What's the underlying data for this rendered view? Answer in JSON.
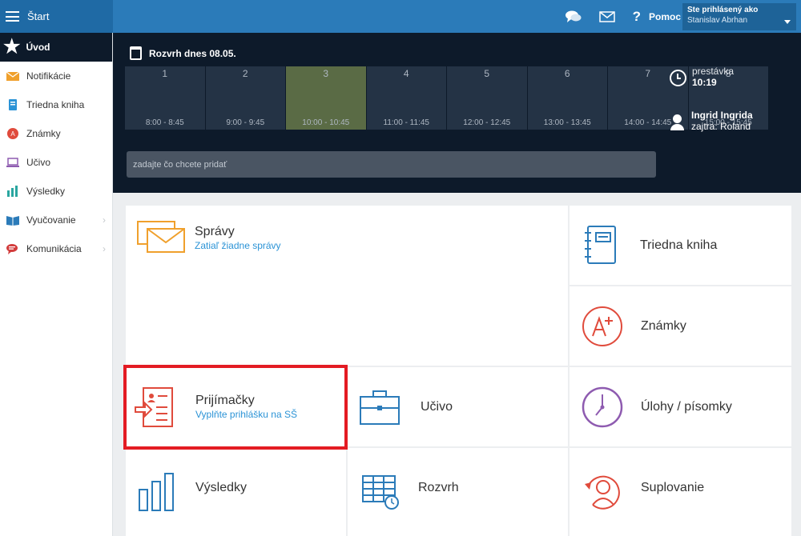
{
  "header": {
    "menu_label": "Štart",
    "help_label": "Pomoc",
    "user_label": "Ste prihlásený ako",
    "user_name": "Stanislav Abrhan"
  },
  "sidebar": {
    "active": "Úvod",
    "items": [
      {
        "label": "Notifikácie",
        "icon": "envelope-icon",
        "color": "#f0a02c"
      },
      {
        "label": "Triedna kniha",
        "icon": "book-icon",
        "color": "#2b93d6"
      },
      {
        "label": "Známky",
        "icon": "grade-icon",
        "color": "#e04b3c"
      },
      {
        "label": "Učivo",
        "icon": "laptop-icon",
        "color": "#8e5bb0"
      },
      {
        "label": "Výsledky",
        "icon": "chart-icon",
        "color": "#2aa6a0"
      },
      {
        "label": "Vyučovanie",
        "icon": "open-book-icon",
        "color": "#2b7bb9"
      },
      {
        "label": "Komunikácia",
        "icon": "chat-icon",
        "color": "#d23c3c"
      }
    ]
  },
  "schedule": {
    "title": "Rozvrh dnes 08.05.",
    "lessons": [
      {
        "num": "1",
        "time": "8:00 - 8:45"
      },
      {
        "num": "2",
        "time": "9:00 - 9:45"
      },
      {
        "num": "3",
        "time": "10:00 - 10:45"
      },
      {
        "num": "4",
        "time": "11:00 - 11:45"
      },
      {
        "num": "5",
        "time": "12:00 - 12:45"
      },
      {
        "num": "6",
        "time": "13:00 - 13:45"
      },
      {
        "num": "7",
        "time": "14:00 - 14:45"
      },
      {
        "num": "8",
        "time": "15:00 - 15:45"
      }
    ],
    "current_lesson": "3",
    "add_placeholder": "zadajte čo chcete pridať",
    "break_label": "prestávka",
    "break_time": "10:19",
    "person_name": "Ingrid Ingrida",
    "tomorrow": "zajtra: Roland"
  },
  "tiles": {
    "spravy": {
      "title": "Správy",
      "sub": "Zatiaľ žiadne správy"
    },
    "triedna": {
      "title": "Triedna kniha"
    },
    "znamky": {
      "title": "Známky"
    },
    "prijimacky": {
      "title": "Prijímačky",
      "sub": "Vyplňte prihlášku na SŠ"
    },
    "ucivo": {
      "title": "Učivo"
    },
    "ulohy": {
      "title": "Úlohy / písomky"
    },
    "vysledky": {
      "title": "Výsledky"
    },
    "rozvrh": {
      "title": "Rozvrh"
    },
    "suplovanie": {
      "title": "Suplovanie"
    }
  },
  "colors": {
    "header": "#2b7bb9",
    "dark": "#0d1a2a",
    "orange": "#f0a02c",
    "blue": "#2b7bb9",
    "red": "#e04b3c",
    "purple": "#8e5bb0",
    "highlight": "#e31b23"
  }
}
